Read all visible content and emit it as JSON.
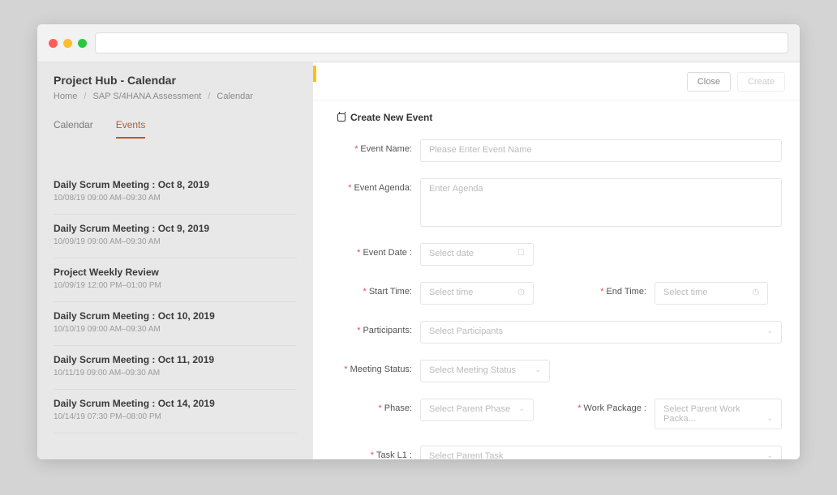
{
  "header": {
    "page_title": "Project Hub - Calendar",
    "breadcrumb": [
      "Home",
      "SAP S/4HANA Assessment",
      "Calendar"
    ]
  },
  "tabs": [
    {
      "label": "Calendar",
      "active": false
    },
    {
      "label": "Events",
      "active": true
    }
  ],
  "events": [
    {
      "title": "Daily Scrum Meeting : Oct 8, 2019",
      "time": "10/08/19  09:00 AM–09:30 AM"
    },
    {
      "title": "Daily Scrum Meeting : Oct 9, 2019",
      "time": "10/09/19  09:00 AM–09:30 AM"
    },
    {
      "title": "Project Weekly Review",
      "time": "10/09/19  12:00 PM–01:00 PM"
    },
    {
      "title": "Daily Scrum Meeting : Oct 10, 2019",
      "time": "10/10/19  09:00 AM–09:30 AM"
    },
    {
      "title": "Daily Scrum Meeting : Oct 11, 2019",
      "time": "10/11/19  09:00 AM–09:30 AM"
    },
    {
      "title": "Daily Scrum Meeting : Oct 14, 2019",
      "time": "10/14/19  07:30 PM–08:00 PM"
    }
  ],
  "panel": {
    "close_label": "Close",
    "create_label": "Create",
    "form_title": "Create New Event",
    "fields": {
      "event_name": {
        "label": "Event Name:",
        "placeholder": "Please Enter Event Name"
      },
      "event_agenda": {
        "label": "Event Agenda:",
        "placeholder": "Enter Agenda"
      },
      "event_date": {
        "label": "Event Date :",
        "placeholder": "Select date"
      },
      "start_time": {
        "label": "Start Time:",
        "placeholder": "Select time"
      },
      "end_time": {
        "label": "End Time:",
        "placeholder": "Select time"
      },
      "participants": {
        "label": "Participants:",
        "placeholder": "Select Participants"
      },
      "meeting_status": {
        "label": "Meeting Status:",
        "placeholder": "Select Meeting Status"
      },
      "phase": {
        "label": "Phase:",
        "placeholder": "Select Parent Phase"
      },
      "work_package": {
        "label": "Work Package :",
        "placeholder": "Select Parent Work Packa..."
      },
      "task_l1": {
        "label": "Task L1 :",
        "placeholder": "Select Parent Task"
      }
    }
  }
}
